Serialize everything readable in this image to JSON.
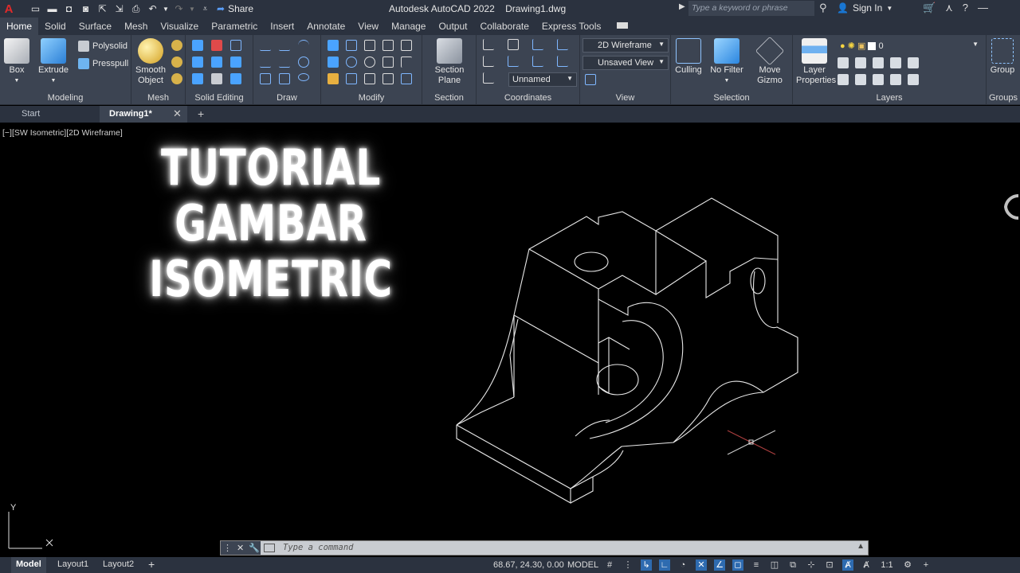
{
  "titlebar": {
    "app_logo": "A",
    "share_label": "Share",
    "app_name": "Autodesk AutoCAD 2022",
    "file_name": "Drawing1.dwg",
    "search_placeholder": "Type a keyword or phrase",
    "signin_label": "Sign In"
  },
  "ribbon_tabs": [
    "Home",
    "Solid",
    "Surface",
    "Mesh",
    "Visualize",
    "Parametric",
    "Insert",
    "Annotate",
    "View",
    "Manage",
    "Output",
    "Collaborate",
    "Express Tools"
  ],
  "ribbon": {
    "modeling": {
      "label": "Modeling",
      "box": "Box",
      "extrude": "Extrude",
      "polysolid": "Polysolid",
      "presspull": "Presspull"
    },
    "mesh": {
      "label": "Mesh",
      "smooth_object": "Smooth Object"
    },
    "solid_editing": {
      "label": "Solid Editing"
    },
    "draw": {
      "label": "Draw"
    },
    "modify": {
      "label": "Modify"
    },
    "section": {
      "label": "Section",
      "section_plane": "Section Plane"
    },
    "coordinates": {
      "label": "Coordinates",
      "ucs_combo": "Unnamed"
    },
    "view": {
      "label": "View",
      "visual_style": "2D Wireframe",
      "saved_view": "Unsaved View"
    },
    "selection": {
      "label": "Selection",
      "culling": "Culling",
      "no_filter": "No Filter",
      "move_gizmo": "Move Gizmo"
    },
    "layers": {
      "label": "Layers",
      "layer_properties": "Layer Properties",
      "current_layer": "0"
    },
    "groups": {
      "label": "Groups",
      "group": "Group"
    }
  },
  "doc_tabs": {
    "start": "Start",
    "drawing": "Drawing1*"
  },
  "viewport": {
    "label": "[−][SW Isometric][2D Wireframe]",
    "overlay_title_line1": "TUTORIAL GAMBAR",
    "overlay_title_line2": "ISOMETRIC",
    "ucs_y": "Y"
  },
  "command_line": {
    "placeholder": "Type a command"
  },
  "status": {
    "model_tab": "Model",
    "layout1": "Layout1",
    "layout2": "Layout2",
    "coords": "68.67, 24.30, 0.00",
    "space": "MODEL",
    "scale": "1:1"
  },
  "colors": {
    "accent": "#2e6bb0",
    "ribbon_bg": "#3c4452",
    "title_bg": "#2b323f"
  }
}
